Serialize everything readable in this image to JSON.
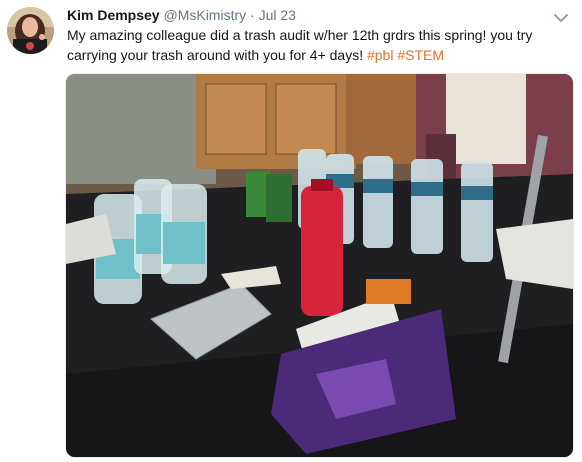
{
  "tweet": {
    "author_name": "Kim Dempsey",
    "handle": "@MsKimistry",
    "separator": "·",
    "date": "Jul 23",
    "text": "My amazing colleague did a trash audit w/her 12th grdrs this spring! you try carrying your trash around with you for 4+ days!",
    "hashtags": [
      "#pbl",
      "#STEM"
    ],
    "avatar_icon": "avatar-photo",
    "menu_icon": "chevron-down-icon",
    "photo_description_icon": "trash-audit-photo"
  },
  "colors": {
    "hashtag": "#e0722c",
    "name": "#14171a",
    "meta": "#657786"
  }
}
